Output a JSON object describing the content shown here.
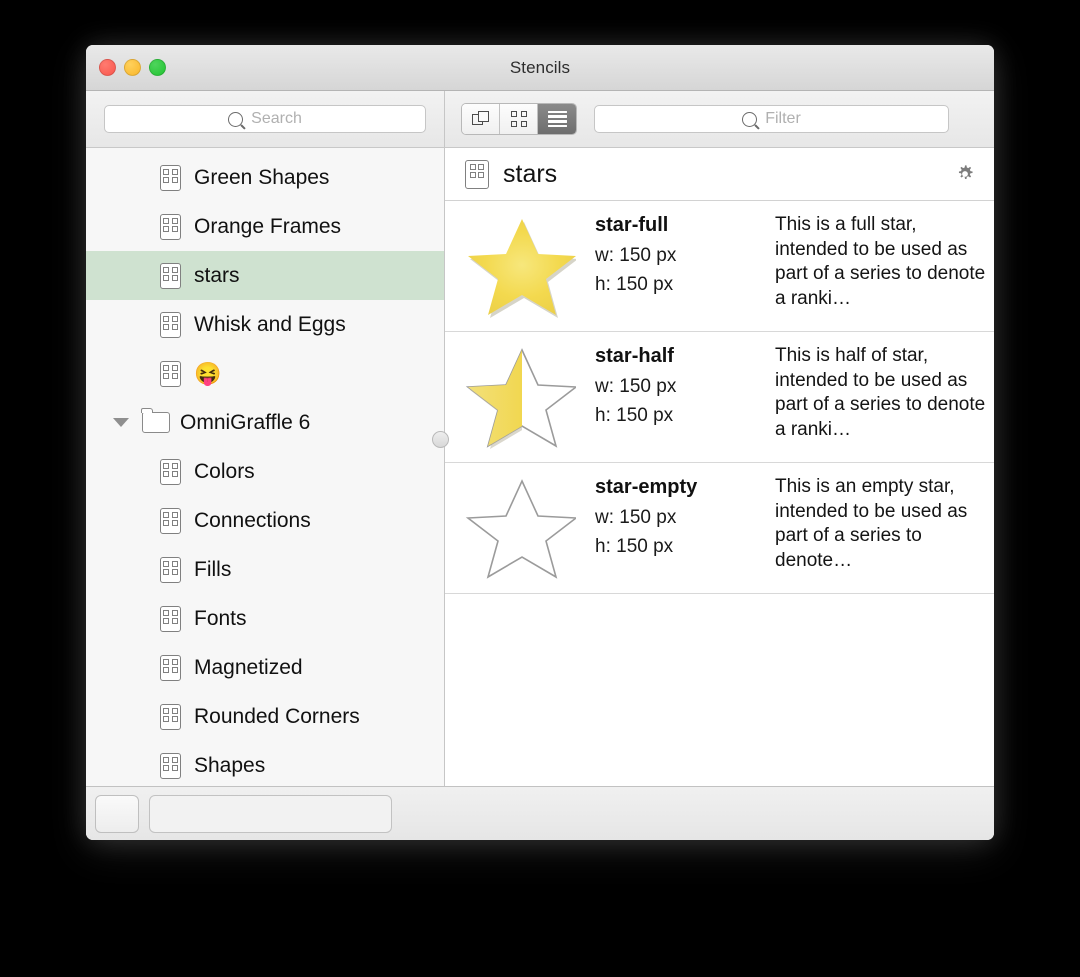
{
  "window": {
    "title": "Stencils",
    "traffic": {
      "close": "close-button",
      "minimize": "minimize-button",
      "zoom": "zoom-button"
    }
  },
  "sidebar": {
    "search": {
      "placeholder": "Search",
      "value": ""
    },
    "items": [
      {
        "label": "Green Shapes",
        "icon": "stencil-icon",
        "type": "stencil",
        "selected": false
      },
      {
        "label": "Orange Frames",
        "icon": "stencil-icon",
        "type": "stencil",
        "selected": false
      },
      {
        "label": "stars",
        "icon": "stencil-icon",
        "type": "stencil",
        "selected": true
      },
      {
        "label": "Whisk and Eggs",
        "icon": "stencil-icon",
        "type": "stencil",
        "selected": false
      },
      {
        "label": "😝",
        "icon": "stencil-icon",
        "type": "stencil-emoji",
        "selected": false
      },
      {
        "label": "OmniGraffle 6",
        "icon": "folder-icon",
        "type": "folder",
        "expanded": true,
        "selected": false
      },
      {
        "label": "Colors",
        "icon": "stencil-icon",
        "type": "stencil",
        "selected": false
      },
      {
        "label": "Connections",
        "icon": "stencil-icon",
        "type": "stencil",
        "selected": false
      },
      {
        "label": "Fills",
        "icon": "stencil-icon",
        "type": "stencil",
        "selected": false
      },
      {
        "label": "Fonts",
        "icon": "stencil-icon",
        "type": "stencil",
        "selected": false
      },
      {
        "label": "Magnetized",
        "icon": "stencil-icon",
        "type": "stencil",
        "selected": false
      },
      {
        "label": "Rounded Corners",
        "icon": "stencil-icon",
        "type": "stencil",
        "selected": false
      },
      {
        "label": "Shapes",
        "icon": "stencil-icon",
        "type": "stencil",
        "selected": false
      }
    ],
    "selection_color": "#cfe2d0"
  },
  "toolbar": {
    "view_modes": [
      {
        "name": "canvas-view",
        "icon": "overlapping-shapes-icon",
        "active": false
      },
      {
        "name": "grid-view",
        "icon": "grid-icon",
        "active": false
      },
      {
        "name": "list-view",
        "icon": "list-icon",
        "active": true
      }
    ],
    "filter": {
      "placeholder": "Filter",
      "value": ""
    }
  },
  "stencil": {
    "title": "stars",
    "icon": "stencil-icon",
    "action_icon": "gear-icon",
    "items": [
      {
        "name": "star-full",
        "width": "w: 150 px",
        "height": "h: 150 px",
        "description": "This is a full star, intended to be used as part of a series to denote a ranki…",
        "shape": "star-full"
      },
      {
        "name": "star-half",
        "width": "w: 150 px",
        "height": "h: 150 px",
        "description": "This is half of star, intended to be used as part of a series to denote a ranki…",
        "shape": "star-half"
      },
      {
        "name": "star-empty",
        "width": "w: 150 px",
        "height": "h: 150 px",
        "description": "This is an empty star, intended to be used as part of a series to denote…",
        "shape": "star-empty"
      }
    ]
  },
  "bottom_bar": {
    "action_button": "",
    "field_value": ""
  },
  "colors": {
    "star_fill": "#f3d94e",
    "star_outline": "#9b9b9b",
    "selection": "#cfe2d0",
    "accent_close": "#f9564d",
    "accent_min": "#f9b62b",
    "accent_zoom": "#22c431"
  }
}
